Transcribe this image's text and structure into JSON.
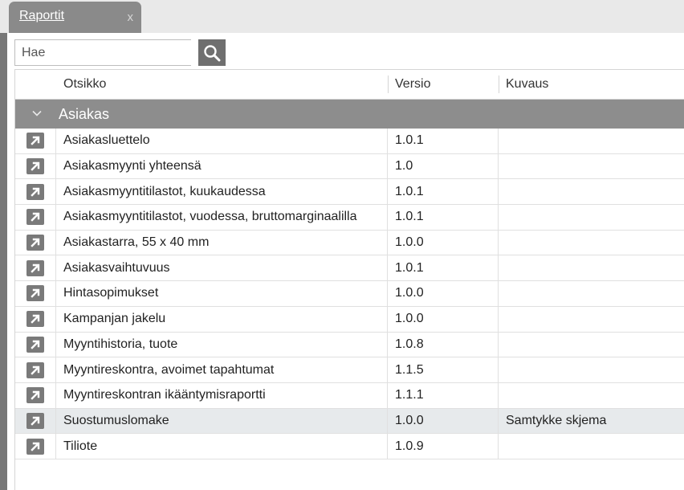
{
  "tabs": [
    {
      "label": "Raportit",
      "close": "x"
    }
  ],
  "search": {
    "placeholder": "Hae",
    "value": ""
  },
  "table": {
    "columns": [
      "Otsikko",
      "Versio",
      "Kuvaus"
    ],
    "group": {
      "label": "Asiakas",
      "expanded": true
    },
    "rows": [
      {
        "title": "Asiakasluettelo",
        "version": "1.0.1",
        "description": ""
      },
      {
        "title": "Asiakasmyynti yhteensä",
        "version": "1.0",
        "description": ""
      },
      {
        "title": "Asiakasmyyntitilastot, kuukaudessa",
        "version": "1.0.1",
        "description": ""
      },
      {
        "title": "Asiakasmyyntitilastot, vuodessa, bruttomarginaalilla",
        "version": "1.0.1",
        "description": ""
      },
      {
        "title": "Asiakastarra, 55 x 40 mm",
        "version": "1.0.0",
        "description": ""
      },
      {
        "title": "Asiakasvaihtuvuus",
        "version": "1.0.1",
        "description": ""
      },
      {
        "title": "Hintasopimukset",
        "version": "1.0.0",
        "description": ""
      },
      {
        "title": "Kampanjan jakelu",
        "version": "1.0.0",
        "description": ""
      },
      {
        "title": "Myyntihistoria, tuote",
        "version": "1.0.8",
        "description": ""
      },
      {
        "title": "Myyntireskontra, avoimet tapahtumat",
        "version": "1.1.5",
        "description": ""
      },
      {
        "title": "Myyntireskontran ikääntymisraportti",
        "version": "1.1.1",
        "description": ""
      },
      {
        "title": "Suostumuslomake",
        "version": "1.0.0",
        "description": "Samtykke skjema",
        "selected": true
      },
      {
        "title": "Tiliote",
        "version": "1.0.9",
        "description": ""
      }
    ]
  },
  "icons": {
    "search": "search-icon",
    "row_action": "open-report-icon",
    "group_toggle": "chevron-down-icon"
  },
  "colors": {
    "tab_bg": "#8a8a8a",
    "group_bg": "#8d8d8d",
    "selected_row": "#e7eaec",
    "search_button": "#6f6f6f"
  }
}
